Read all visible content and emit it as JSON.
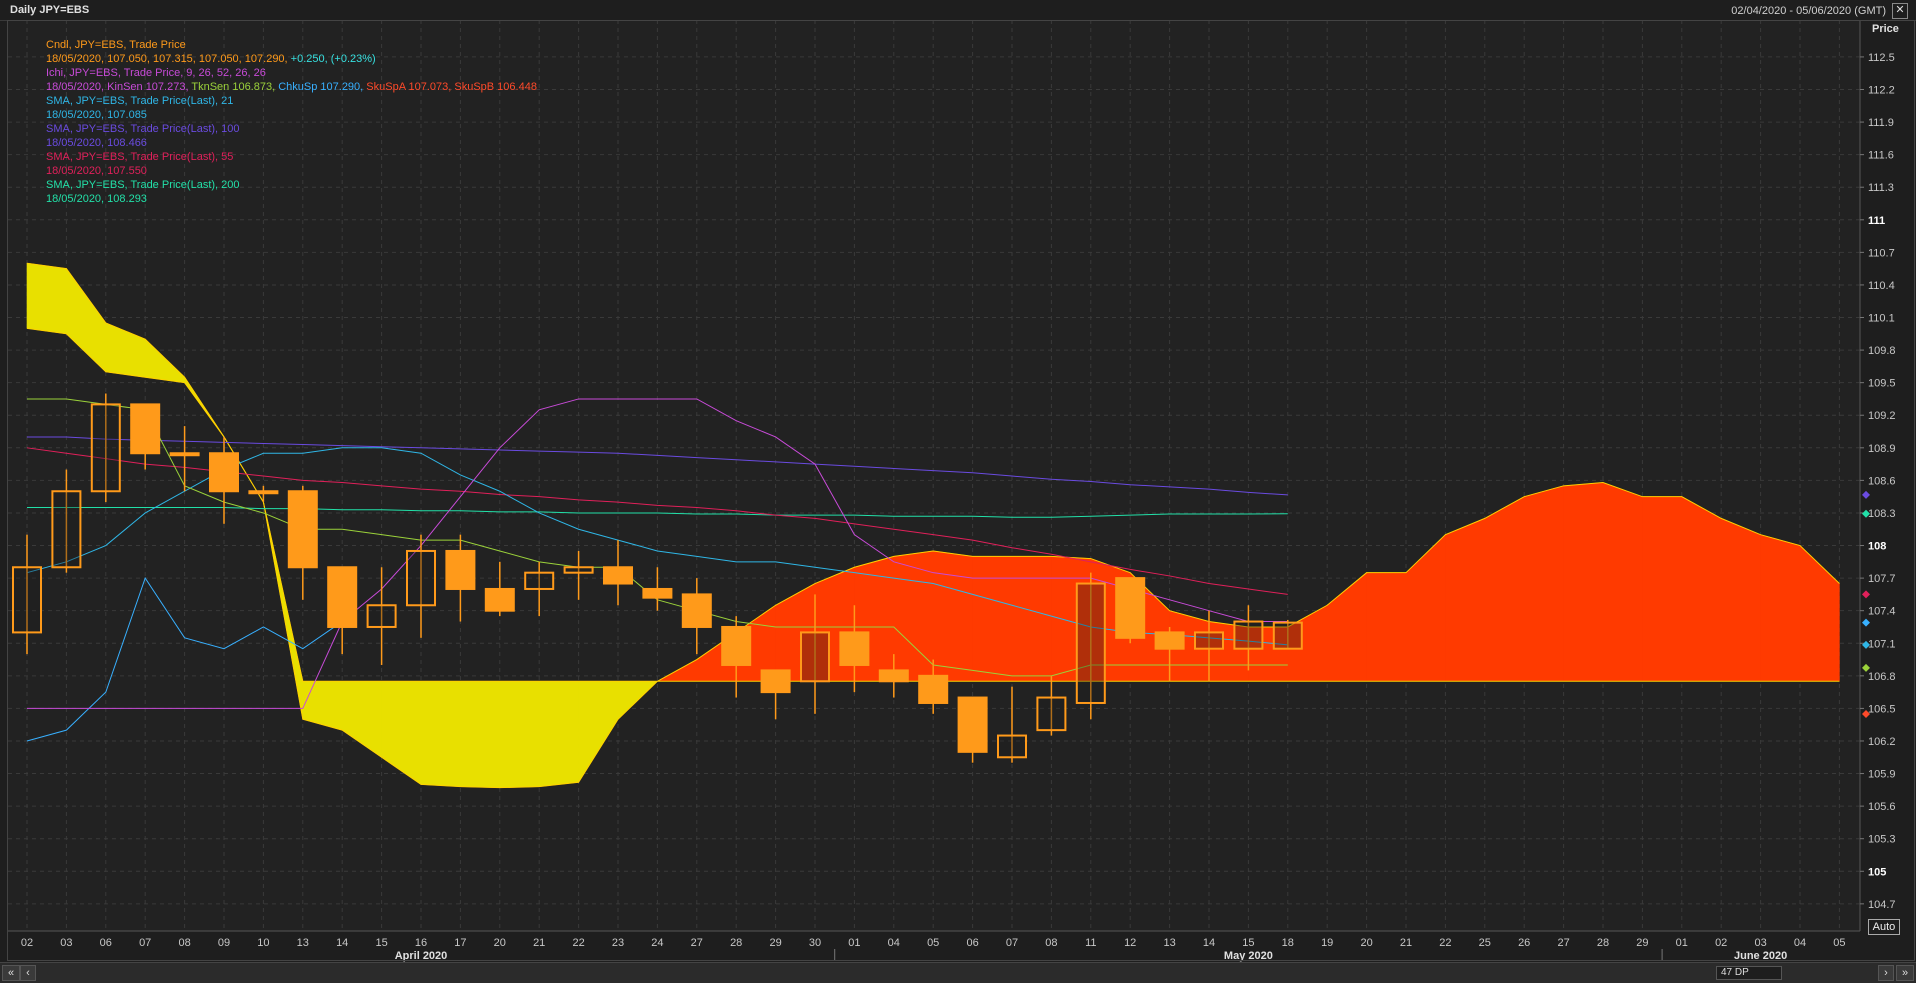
{
  "window": {
    "title": "Daily JPY=EBS",
    "date_range": "02/04/2020 - 05/06/2020 (GMT)",
    "close_label": "✕"
  },
  "legend": [
    {
      "text": "Cndl, JPY=EBS, Trade Price",
      "color": "#ff9a1a"
    },
    {
      "parts": [
        {
          "text": "18/05/2020, 107.050, 107.315, 107.050, 107.290, ",
          "color": "#ff9a1a"
        },
        {
          "text": "+0.250, (+0.23%)",
          "color": "#37e0e0"
        }
      ]
    },
    {
      "text": "Ichi, JPY=EBS, Trade Price,  9, 26, 52, 26, 26",
      "color": "#c84bd8"
    },
    {
      "parts": [
        {
          "text": "18/05/2020, KinSen 107.273, ",
          "color": "#c84bd8"
        },
        {
          "text": "TknSen 106.873, ",
          "color": "#9bd23a"
        },
        {
          "text": "ChkuSp 107.290, ",
          "color": "#38b0ff"
        },
        {
          "text": "SkuSpA 107.073, ",
          "color": "#ff4a2a"
        },
        {
          "text": "SkuSpB 106.448",
          "color": "#ff4a2a"
        }
      ]
    },
    {
      "text": "SMA, JPY=EBS, Trade Price(Last),  21",
      "color": "#2fb6e6"
    },
    {
      "text": "18/05/2020, 107.085",
      "color": "#2fb6e6"
    },
    {
      "text": "SMA, JPY=EBS, Trade Price(Last),  100",
      "color": "#6a4be0"
    },
    {
      "text": "18/05/2020, 108.466",
      "color": "#6a4be0"
    },
    {
      "text": "SMA, JPY=EBS, Trade Price(Last),  55",
      "color": "#e0205a"
    },
    {
      "text": "18/05/2020, 107.550",
      "color": "#e0205a"
    },
    {
      "text": "SMA, JPY=EBS, Trade Price(Last),  200",
      "color": "#22e0a8"
    },
    {
      "text": "18/05/2020, 108.293",
      "color": "#22e0a8"
    }
  ],
  "scrollbar": {
    "dp_label": "47 DP",
    "auto_label": "Auto"
  },
  "chart_data": {
    "type": "line",
    "ylabel": "Price",
    "ylim": [
      104.45,
      112.84
    ],
    "y_ticks": [
      "112.5",
      "112.2",
      "111.9",
      "111.6",
      "111.3",
      "111",
      "110.7",
      "110.4",
      "110.1",
      "109.8",
      "109.5",
      "109.2",
      "108.9",
      "108.6",
      "108.3",
      "108",
      "107.7",
      "107.4",
      "107.1",
      "106.8",
      "106.5",
      "106.2",
      "105.9",
      "105.6",
      "105.3",
      "105",
      "104.7"
    ],
    "y_ticks_bold": [
      "111",
      "108",
      "105"
    ],
    "x_labels": [
      "02",
      "03",
      "06",
      "07",
      "08",
      "09",
      "10",
      "13",
      "14",
      "15",
      "16",
      "17",
      "20",
      "21",
      "22",
      "23",
      "24",
      "27",
      "28",
      "29",
      "30",
      "01",
      "04",
      "05",
      "06",
      "07",
      "08",
      "11",
      "12",
      "13",
      "14",
      "15",
      "18",
      "19",
      "20",
      "21",
      "22",
      "25",
      "26",
      "27",
      "28",
      "29",
      "01",
      "02",
      "03",
      "04",
      "05"
    ],
    "month_labels": [
      {
        "label": "April 2020",
        "index": 10
      },
      {
        "label": "May 2020",
        "index": 31
      },
      {
        "label": "June 2020",
        "index": 44
      }
    ],
    "candles": [
      {
        "x": "02",
        "o": 107.2,
        "h": 108.1,
        "l": 107.0,
        "c": 107.8
      },
      {
        "x": "03",
        "o": 107.8,
        "h": 108.7,
        "l": 107.75,
        "c": 108.5
      },
      {
        "x": "06",
        "o": 108.5,
        "h": 109.4,
        "l": 108.4,
        "c": 109.3
      },
      {
        "x": "07",
        "o": 109.3,
        "h": 109.3,
        "l": 108.7,
        "c": 108.85
      },
      {
        "x": "08",
        "o": 108.85,
        "h": 109.1,
        "l": 108.5,
        "c": 108.85
      },
      {
        "x": "09",
        "o": 108.85,
        "h": 109.0,
        "l": 108.2,
        "c": 108.5
      },
      {
        "x": "10",
        "o": 108.5,
        "h": 108.55,
        "l": 108.4,
        "c": 108.5
      },
      {
        "x": "13",
        "o": 108.5,
        "h": 108.55,
        "l": 107.5,
        "c": 107.8
      },
      {
        "x": "14",
        "o": 107.8,
        "h": 107.8,
        "l": 107.0,
        "c": 107.25
      },
      {
        "x": "15",
        "o": 107.25,
        "h": 107.8,
        "l": 106.9,
        "c": 107.45
      },
      {
        "x": "16",
        "o": 107.45,
        "h": 108.1,
        "l": 107.15,
        "c": 107.95
      },
      {
        "x": "17",
        "o": 107.95,
        "h": 108.1,
        "l": 107.3,
        "c": 107.6
      },
      {
        "x": "20",
        "o": 107.6,
        "h": 107.85,
        "l": 107.35,
        "c": 107.4
      },
      {
        "x": "21",
        "o": 107.6,
        "h": 107.85,
        "l": 107.35,
        "c": 107.75
      },
      {
        "x": "22",
        "o": 107.75,
        "h": 107.95,
        "l": 107.5,
        "c": 107.8
      },
      {
        "x": "23",
        "o": 107.8,
        "h": 108.05,
        "l": 107.45,
        "c": 107.65
      },
      {
        "x": "24",
        "o": 107.6,
        "h": 107.8,
        "l": 107.4,
        "c": 107.52
      },
      {
        "x": "27",
        "o": 107.55,
        "h": 107.7,
        "l": 107.0,
        "c": 107.25
      },
      {
        "x": "28",
        "o": 107.25,
        "h": 107.35,
        "l": 106.6,
        "c": 106.9
      },
      {
        "x": "29",
        "o": 106.85,
        "h": 106.85,
        "l": 106.4,
        "c": 106.65
      },
      {
        "x": "30",
        "o": 106.75,
        "h": 107.55,
        "l": 106.45,
        "c": 107.2
      },
      {
        "x": "01",
        "o": 107.2,
        "h": 107.45,
        "l": 106.65,
        "c": 106.9
      },
      {
        "x": "04",
        "o": 106.85,
        "h": 107.0,
        "l": 106.6,
        "c": 106.75
      },
      {
        "x": "05",
        "o": 106.8,
        "h": 106.95,
        "l": 106.45,
        "c": 106.55
      },
      {
        "x": "06",
        "o": 106.6,
        "h": 106.6,
        "l": 106.0,
        "c": 106.1
      },
      {
        "x": "07",
        "o": 106.05,
        "h": 106.7,
        "l": 106.0,
        "c": 106.25
      },
      {
        "x": "08",
        "o": 106.3,
        "h": 106.8,
        "l": 106.25,
        "c": 106.6
      },
      {
        "x": "11",
        "o": 106.55,
        "h": 107.75,
        "l": 106.4,
        "c": 107.65
      },
      {
        "x": "12",
        "o": 107.7,
        "h": 107.7,
        "l": 107.1,
        "c": 107.15
      },
      {
        "x": "13",
        "o": 107.2,
        "h": 107.25,
        "l": 106.75,
        "c": 107.05
      },
      {
        "x": "14",
        "o": 107.05,
        "h": 107.4,
        "l": 106.75,
        "c": 107.2
      },
      {
        "x": "15",
        "o": 107.05,
        "h": 107.45,
        "l": 106.85,
        "c": 107.3
      },
      {
        "x": "18",
        "o": 107.05,
        "h": 107.315,
        "l": 107.05,
        "c": 107.29
      }
    ],
    "series": [
      {
        "name": "SkuSpA",
        "color": "#ffd000",
        "values": [
          110.0,
          109.95,
          109.6,
          109.55,
          109.5,
          109.0,
          108.4,
          106.4,
          106.3,
          106.05,
          105.8,
          105.78,
          105.77,
          105.78,
          105.82,
          106.4,
          106.75,
          106.95,
          107.2,
          107.45,
          107.65,
          107.8,
          107.9,
          107.95,
          107.9,
          107.9,
          107.9,
          107.88,
          107.75,
          107.4,
          107.3,
          107.25,
          107.25,
          107.45,
          107.75,
          107.75,
          108.1,
          108.25,
          108.45,
          108.55,
          108.58,
          108.45,
          108.45,
          108.25,
          108.1,
          108.0,
          107.65
        ]
      },
      {
        "name": "SkuSpB",
        "color": "#ffd000",
        "values": [
          110.6,
          110.55,
          110.05,
          109.9,
          109.55,
          109.0,
          108.4,
          106.75,
          106.75,
          106.75,
          106.75,
          106.75,
          106.75,
          106.75,
          106.75,
          106.75,
          106.75,
          106.75,
          106.75,
          106.75,
          106.75,
          106.75,
          106.75,
          106.75,
          106.75,
          106.75,
          106.75,
          106.75,
          106.75,
          106.75,
          106.75,
          106.75,
          106.75,
          106.75,
          106.75,
          106.75,
          106.75,
          106.75,
          106.75,
          106.75,
          106.75,
          106.75,
          106.75,
          106.75,
          106.75,
          106.75,
          106.75
        ]
      },
      {
        "name": "KinSen",
        "color": "#c84bd8",
        "values": [
          106.5,
          106.5,
          106.5,
          106.5,
          106.5,
          106.5,
          106.5,
          106.5,
          107.3,
          107.6,
          108.0,
          108.45,
          108.9,
          109.25,
          109.35,
          109.35,
          109.35,
          109.35,
          109.15,
          109.0,
          108.75,
          108.1,
          107.85,
          107.75,
          107.7,
          107.7,
          107.7,
          107.7,
          107.6,
          107.5,
          107.4,
          107.3,
          107.3
        ]
      },
      {
        "name": "TknSen",
        "color": "#9bd23a",
        "values": [
          109.35,
          109.35,
          109.3,
          109.25,
          108.55,
          108.4,
          108.3,
          108.15,
          108.15,
          108.1,
          108.05,
          108.05,
          107.95,
          107.85,
          107.8,
          107.8,
          107.5,
          107.4,
          107.3,
          107.25,
          107.25,
          107.25,
          107.25,
          106.9,
          106.85,
          106.8,
          106.8,
          106.9,
          106.9,
          106.9,
          106.9,
          106.9,
          106.9
        ]
      },
      {
        "name": "ChkuSp",
        "color": "#38b0ff",
        "values": [
          106.2,
          106.3,
          106.65,
          107.7,
          107.15,
          107.05,
          107.25,
          107.05,
          107.3
        ]
      },
      {
        "name": "SMA 21",
        "color": "#2fb6e6",
        "values": [
          107.75,
          107.85,
          108.0,
          108.3,
          108.5,
          108.7,
          108.85,
          108.85,
          108.9,
          108.9,
          108.85,
          108.65,
          108.5,
          108.3,
          108.15,
          108.05,
          107.95,
          107.9,
          107.85,
          107.85,
          107.8,
          107.75,
          107.7,
          107.65,
          107.55,
          107.45,
          107.35,
          107.25,
          107.2,
          107.18,
          107.15,
          107.12,
          107.085
        ]
      },
      {
        "name": "SMA 100",
        "color": "#6a4be0",
        "values": [
          109.0,
          109.0,
          108.98,
          108.97,
          108.96,
          108.95,
          108.94,
          108.93,
          108.92,
          108.91,
          108.9,
          108.89,
          108.88,
          108.87,
          108.86,
          108.85,
          108.83,
          108.81,
          108.79,
          108.77,
          108.75,
          108.73,
          108.71,
          108.69,
          108.67,
          108.64,
          108.61,
          108.59,
          108.56,
          108.54,
          108.52,
          108.49,
          108.466
        ]
      },
      {
        "name": "SMA 55",
        "color": "#e0205a",
        "values": [
          108.9,
          108.85,
          108.8,
          108.75,
          108.72,
          108.68,
          108.64,
          108.6,
          108.58,
          108.55,
          108.52,
          108.5,
          108.47,
          108.45,
          108.42,
          108.4,
          108.37,
          108.35,
          108.32,
          108.28,
          108.25,
          108.2,
          108.15,
          108.1,
          108.05,
          107.98,
          107.92,
          107.85,
          107.78,
          107.72,
          107.65,
          107.6,
          107.55
        ]
      },
      {
        "name": "SMA 200",
        "color": "#22e0a8",
        "values": [
          108.35,
          108.35,
          108.35,
          108.35,
          108.35,
          108.35,
          108.34,
          108.34,
          108.33,
          108.33,
          108.32,
          108.32,
          108.31,
          108.31,
          108.3,
          108.3,
          108.3,
          108.29,
          108.29,
          108.28,
          108.28,
          108.28,
          108.27,
          108.27,
          108.27,
          108.26,
          108.26,
          108.27,
          108.28,
          108.29,
          108.29,
          108.29,
          108.293
        ]
      }
    ],
    "cloud_colors": {
      "bull": "#ff3a00",
      "bear": "#e8e000"
    },
    "candle_color": "#ff9a1a",
    "edge_markers": [
      {
        "value": 108.466,
        "color": "#6a4be0"
      },
      {
        "value": 108.293,
        "color": "#22e0a8"
      },
      {
        "value": 107.55,
        "color": "#e0205a"
      },
      {
        "value": 107.29,
        "color": "#38b0ff"
      },
      {
        "value": 107.085,
        "color": "#2fb6e6"
      },
      {
        "value": 106.873,
        "color": "#9bd23a"
      },
      {
        "value": 106.448,
        "color": "#ff4a2a"
      }
    ]
  }
}
